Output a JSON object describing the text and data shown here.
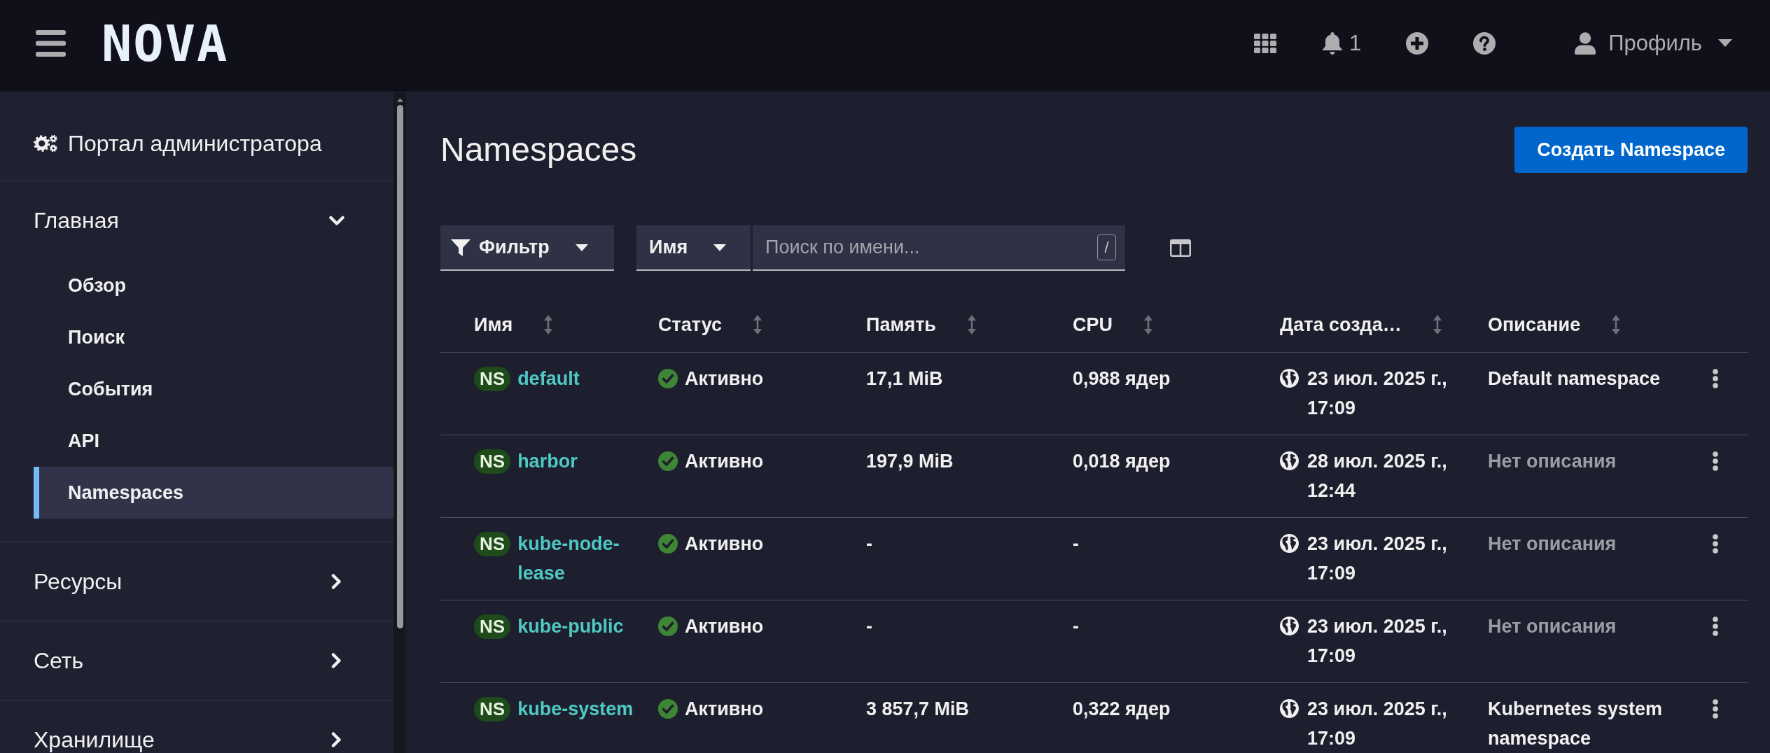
{
  "topbar": {
    "logo": "NOVA",
    "notification_count": "1",
    "profile": "Профиль"
  },
  "sidebar": {
    "title": "Портал администратора",
    "sections": [
      {
        "label": "Главная",
        "expanded": true,
        "children": [
          {
            "label": "Обзор",
            "selected": false
          },
          {
            "label": "Поиск",
            "selected": false
          },
          {
            "label": "События",
            "selected": false
          },
          {
            "label": "API",
            "selected": false
          },
          {
            "label": "Namespaces",
            "selected": true
          }
        ]
      },
      {
        "label": "Ресурсы",
        "expanded": false
      },
      {
        "label": "Сеть",
        "expanded": false
      },
      {
        "label": "Хранилище",
        "expanded": false
      }
    ]
  },
  "page": {
    "title": "Namespaces",
    "create_button": "Создать Namespace"
  },
  "toolbar": {
    "filter": "Фильтр",
    "attribute": "Имя",
    "search": {
      "placeholder": "Поиск по имени...",
      "shortcut": "/"
    }
  },
  "table": {
    "columns": [
      {
        "label": "Имя",
        "sortable": true
      },
      {
        "label": "Статус",
        "sortable": true
      },
      {
        "label": "Память",
        "sortable": true
      },
      {
        "label": "CPU",
        "sortable": true
      },
      {
        "label": "Дата созда…",
        "sortable": true
      },
      {
        "label": "Описание",
        "sortable": true
      }
    ],
    "rows": [
      {
        "badge": "NS",
        "name": "default",
        "status": {
          "label": "Активно",
          "kind": "ok"
        },
        "memory": "17,1 MiB",
        "cpu": "0,988 ядер",
        "created": "23 июл. 2025 г., 17:09",
        "description": "Default namespace",
        "description_missing": false
      },
      {
        "badge": "NS",
        "name": "harbor",
        "status": {
          "label": "Активно",
          "kind": "ok"
        },
        "memory": "197,9 MiB",
        "cpu": "0,018 ядер",
        "created": "28 июл. 2025 г., 12:44",
        "description": "Нет описания",
        "description_missing": true
      },
      {
        "badge": "NS",
        "name": "kube-node-lease",
        "status": {
          "label": "Активно",
          "kind": "ok"
        },
        "memory": "-",
        "cpu": "-",
        "created": "23 июл. 2025 г., 17:09",
        "description": "Нет описания",
        "description_missing": true
      },
      {
        "badge": "NS",
        "name": "kube-public",
        "status": {
          "label": "Активно",
          "kind": "ok"
        },
        "memory": "-",
        "cpu": "-",
        "created": "23 июл. 2025 г., 17:09",
        "description": "Нет описания",
        "description_missing": true
      },
      {
        "badge": "NS",
        "name": "kube-system",
        "status": {
          "label": "Активно",
          "kind": "ok"
        },
        "memory": "3 857,7 MiB",
        "cpu": "0,322 ядер",
        "created": "23 июл. 2025 г., 17:09",
        "description": "Kubernetes system namespace",
        "description_missing": false
      }
    ]
  }
}
